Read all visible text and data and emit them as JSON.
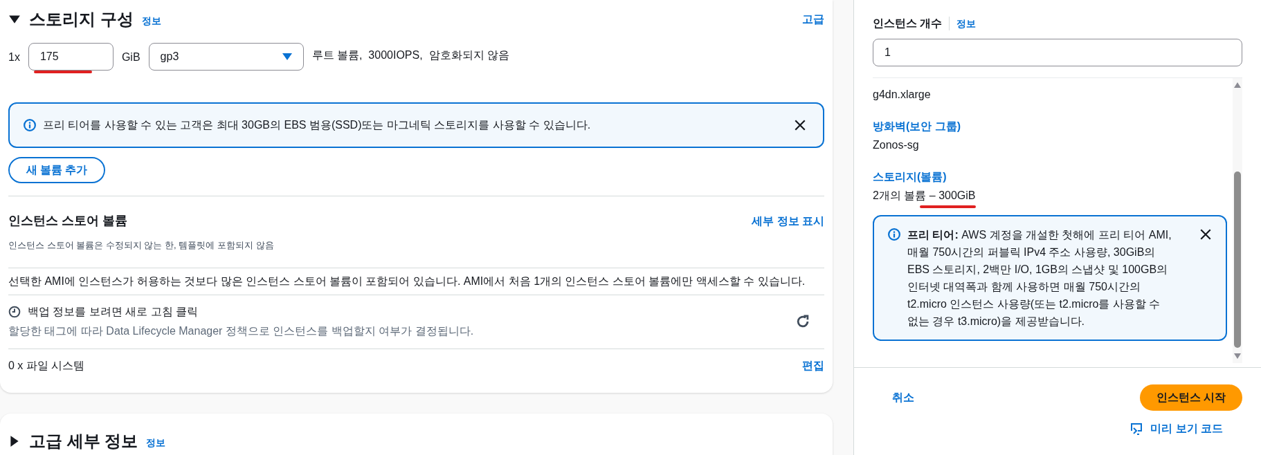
{
  "storage": {
    "expanded": true,
    "title": "스토리지 구성",
    "info_link": "정보",
    "advanced_link": "고급",
    "volume": {
      "count": "1x",
      "size": "175",
      "unit": "GiB",
      "type": "gp3",
      "description": "루트 볼륨,  3000IOPS,  암호화되지 않음"
    },
    "alert": {
      "text": "프리 티어를 사용할 수 있는 고객은 최대 30GB의 EBS 범용(SSD)또는 마그네틱 스토리지를 사용할 수 있습니다."
    },
    "add_volume_button": "새 볼륨 추가",
    "instance_store": {
      "title": "인스턴스 스토어 볼륨",
      "details_link": "세부 정보 표시",
      "subtitle": "인스턴스 스토어 볼륨은 수정되지 않는 한, 템플릿에 포함되지 않음",
      "notice": "선택한 AMI에 인스턴스가 허용하는 것보다 많은 인스턴스 스토어 볼륨이 포함되어 있습니다. AMI에서 처음 1개의 인스턴스 스토어 볼륨에만 액세스할 수 있습니다."
    },
    "backup": {
      "title": "백업 정보를 보려면 새로 고침 클릭",
      "description": "할당한 태그에 따라 Data Lifecycle Manager 정책으로 인스턴스를 백업할지 여부가 결정됩니다."
    },
    "file_systems": {
      "label": "0 x 파일 시스템",
      "edit_link": "편집"
    }
  },
  "advanced": {
    "expanded": false,
    "title": "고급 세부 정보",
    "info_link": "정보"
  },
  "summary": {
    "count_label": "인스턴스 개수",
    "info_link": "정보",
    "count_value": "1",
    "items": [
      {
        "value": "g4dn.xlarge"
      },
      {
        "label": "방화벽(보안 그룹)",
        "value": "Zonos-sg"
      },
      {
        "label": "스토리지(볼륨)",
        "value": "2개의 볼륨 – 300GiB",
        "underlined": true
      }
    ],
    "alert": {
      "text": "**프리 티어:** AWS 계정을 개설한 첫해에 프리 티어 AMI, 매월 750시간의 퍼블릭 IPv4 주소 사용량, 30GiB의 EBS 스토리지, 2백만 I/O, 1GB의 스냅샷 및 100GB의 인터넷 대역폭과 함께 사용하면 매월 750시간의 t2.micro 인스턴스 사용량(또는 t2.micro를 사용할 수 없는 경우 t3.micro)을 제공받습니다."
    },
    "cancel": "취소",
    "launch": "인스턴스 시작",
    "preview_code": "미리 보기 코드"
  }
}
